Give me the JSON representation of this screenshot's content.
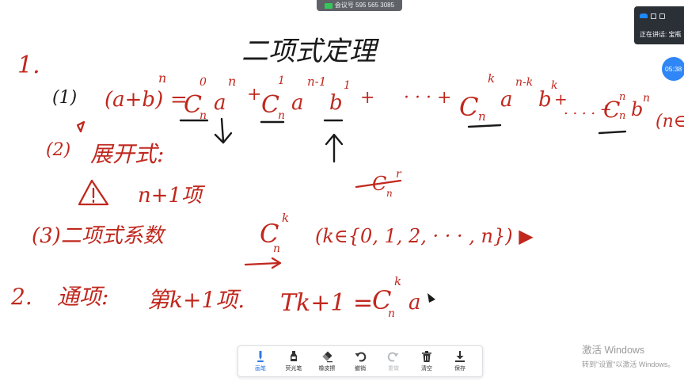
{
  "meeting": {
    "id_text": "会议号 595 565 3085"
  },
  "speaker": {
    "text": "正在讲话: 宝瓶"
  },
  "timer": {
    "text": "05:38"
  },
  "whiteboard": {
    "title": "二项式定理",
    "section1_number": "1.",
    "item1_label": "(1)",
    "item2_label": "(2)",
    "item2_text": "展开式:",
    "warning_text": "n+1项",
    "item3_label": "(3)二项式系数",
    "section2_number": "2.",
    "section2_text": "通项:",
    "term_label": "第k+1项.",
    "term_symbol": "Tk+1 ="
  },
  "toolbar": {
    "items": [
      {
        "label": "画笔",
        "icon": "pen-icon",
        "active": true
      },
      {
        "label": "荧光笔",
        "icon": "highlighter-icon"
      },
      {
        "label": "橡皮擦",
        "icon": "eraser-icon"
      },
      {
        "label": "撤销",
        "icon": "undo-icon"
      },
      {
        "label": "重做",
        "icon": "redo-icon",
        "disabled": true
      },
      {
        "label": "清空",
        "icon": "trash-icon"
      },
      {
        "label": "保存",
        "icon": "save-icon"
      }
    ]
  },
  "activation": {
    "line1": "激活 Windows",
    "line2": "转到\"设置\"以激活 Windows。"
  },
  "colors": {
    "ink_red": "#c0281e",
    "ink_black": "#1a1a1a",
    "accent": "#2f78e6"
  }
}
